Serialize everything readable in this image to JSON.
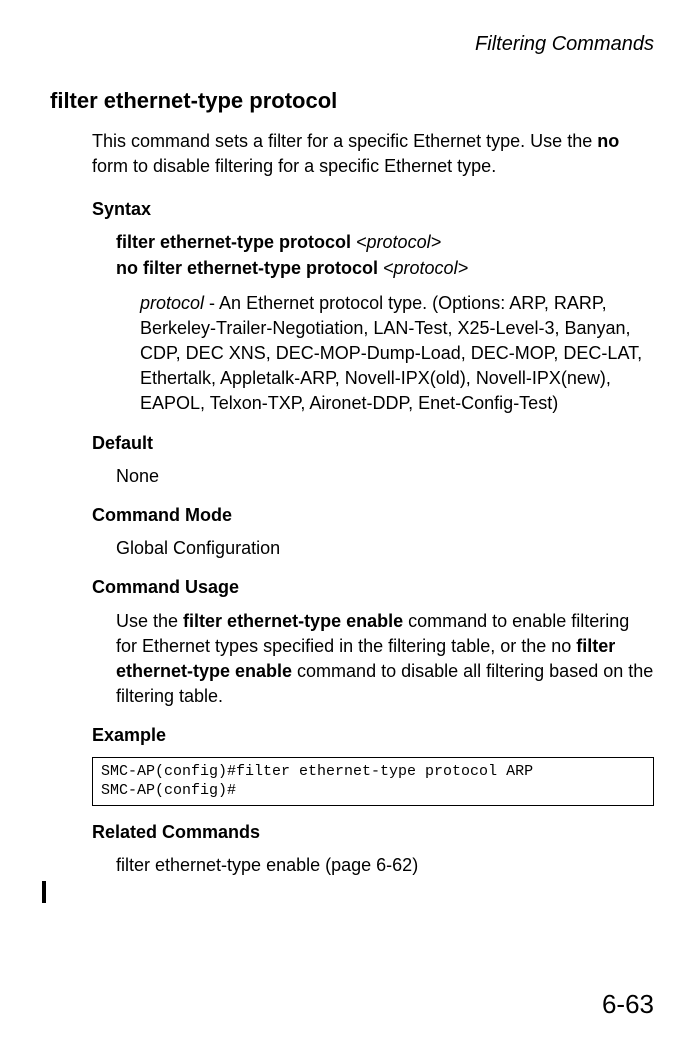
{
  "header": {
    "section_title": "Filtering Commands"
  },
  "command": {
    "title": "filter ethernet-type protocol",
    "description_pre": "This command sets a filter for a specific Ethernet type. Use the ",
    "description_bold": "no",
    "description_post": " form to disable filtering for a specific Ethernet type."
  },
  "syntax": {
    "heading": "Syntax",
    "line1_bold": "filter ethernet-type protocol ",
    "line1_italic": "<protocol>",
    "line2_bold": "no filter ethernet-type protocol ",
    "line2_italic": "<protocol>",
    "param_name": "protocol",
    "param_desc": " - An Ethernet protocol type. (Options: ARP, RARP, Berkeley-Trailer-Negotiation, LAN-Test, X25-Level-3, Banyan, CDP, DEC XNS, DEC-MOP-Dump-Load, DEC-MOP, DEC-LAT, Ethertalk, Appletalk-ARP, Novell-IPX(old), Novell-IPX(new), EAPOL, Telxon-TXP, Aironet-DDP, Enet-Config-Test)"
  },
  "default": {
    "heading": "Default",
    "value": "None"
  },
  "command_mode": {
    "heading": "Command Mode",
    "value": "Global Configuration"
  },
  "command_usage": {
    "heading": "Command Usage",
    "pre1": "Use the ",
    "bold1": "filter ethernet-type enable",
    "mid1": " command to enable filtering for Ethernet types specified in the filtering table, or the no ",
    "bold2": "filter ethernet-type enable",
    "post1": " command to disable all filtering based on the filtering table."
  },
  "example": {
    "heading": "Example",
    "code": "SMC-AP(config)#filter ethernet-type protocol ARP\nSMC-AP(config)#"
  },
  "related": {
    "heading": "Related Commands",
    "text": "filter ethernet-type enable (page 6-62)"
  },
  "page_number": "6-63"
}
